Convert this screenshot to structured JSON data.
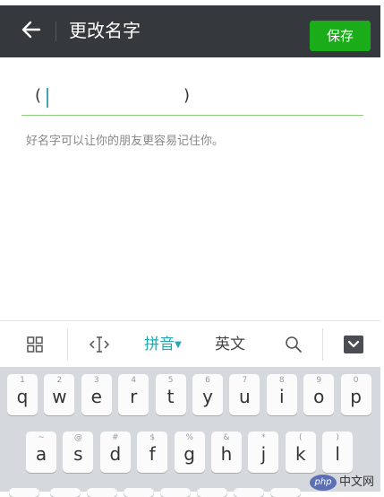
{
  "header": {
    "title": "更改名字",
    "save_label": "保存"
  },
  "name_field": {
    "left_paren": "(",
    "right_paren": ")",
    "value": ""
  },
  "hint_text": "好名字可以让你的朋友更容易记住你。",
  "ime_toolbar": {
    "pinyin_label": "拼音",
    "english_label": "英文"
  },
  "keyboard": {
    "row1": [
      {
        "n": "1",
        "k": "q"
      },
      {
        "n": "2",
        "k": "w"
      },
      {
        "n": "3",
        "k": "e"
      },
      {
        "n": "4",
        "k": "r"
      },
      {
        "n": "5",
        "k": "t"
      },
      {
        "n": "6",
        "k": "y"
      },
      {
        "n": "7",
        "k": "u"
      },
      {
        "n": "8",
        "k": "i"
      },
      {
        "n": "9",
        "k": "o"
      },
      {
        "n": "0",
        "k": "p"
      }
    ],
    "row2": [
      {
        "n": "~",
        "k": "a"
      },
      {
        "n": "@",
        "k": "s"
      },
      {
        "n": "#",
        "k": "d"
      },
      {
        "n": "$",
        "k": "f"
      },
      {
        "n": "%",
        "k": "g"
      },
      {
        "n": "&",
        "k": "h"
      },
      {
        "n": "*",
        "k": "j"
      },
      {
        "n": "(",
        "k": "k"
      },
      {
        "n": ")",
        "k": "l"
      }
    ]
  },
  "watermark": {
    "logo": "php",
    "text": "中文网"
  },
  "colors": {
    "header_bg": "#35383d",
    "save_button": "#1aad19",
    "underline": "#8fcc7a",
    "active_tab": "#24a7b5",
    "keyboard_bg": "#d5d8dd"
  }
}
